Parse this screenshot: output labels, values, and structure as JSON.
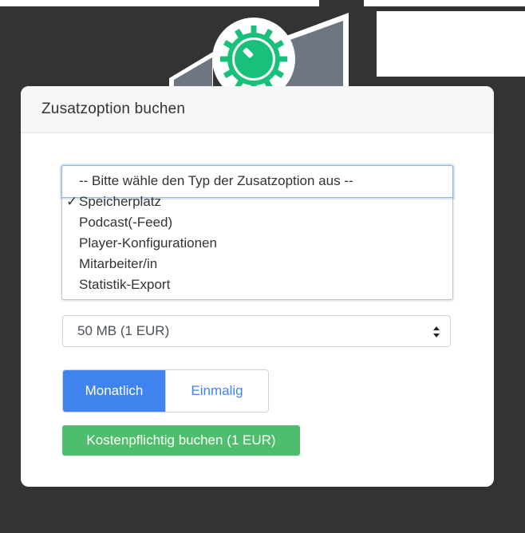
{
  "card": {
    "title": "Zusatzoption buchen"
  },
  "type_dropdown": {
    "options": [
      "-- Bitte wähle den Typ der Zusatzoption aus --",
      "Speicherplatz",
      "Podcast(-Feed)",
      "Player-Konfigurationen",
      "Mitarbeiter/in",
      "Statistik-Export"
    ],
    "selected": "Speicherplatz",
    "checkmark": "✓"
  },
  "size_select": {
    "value": "50 MB (1 EUR)"
  },
  "billing_toggle": {
    "monthly": "Monatlich",
    "once": "Einmalig",
    "active": "monthly"
  },
  "book_button": {
    "label": "Kostenpflichtig buchen (1 EUR)"
  },
  "icons": {
    "illustration": "gear-dial-icon",
    "select_arrows": "sort-arrows-icon"
  },
  "colors": {
    "primary": "#3f83ee",
    "success": "#4ebd6e",
    "brand_green": "#18c07a",
    "background": "#333333"
  }
}
